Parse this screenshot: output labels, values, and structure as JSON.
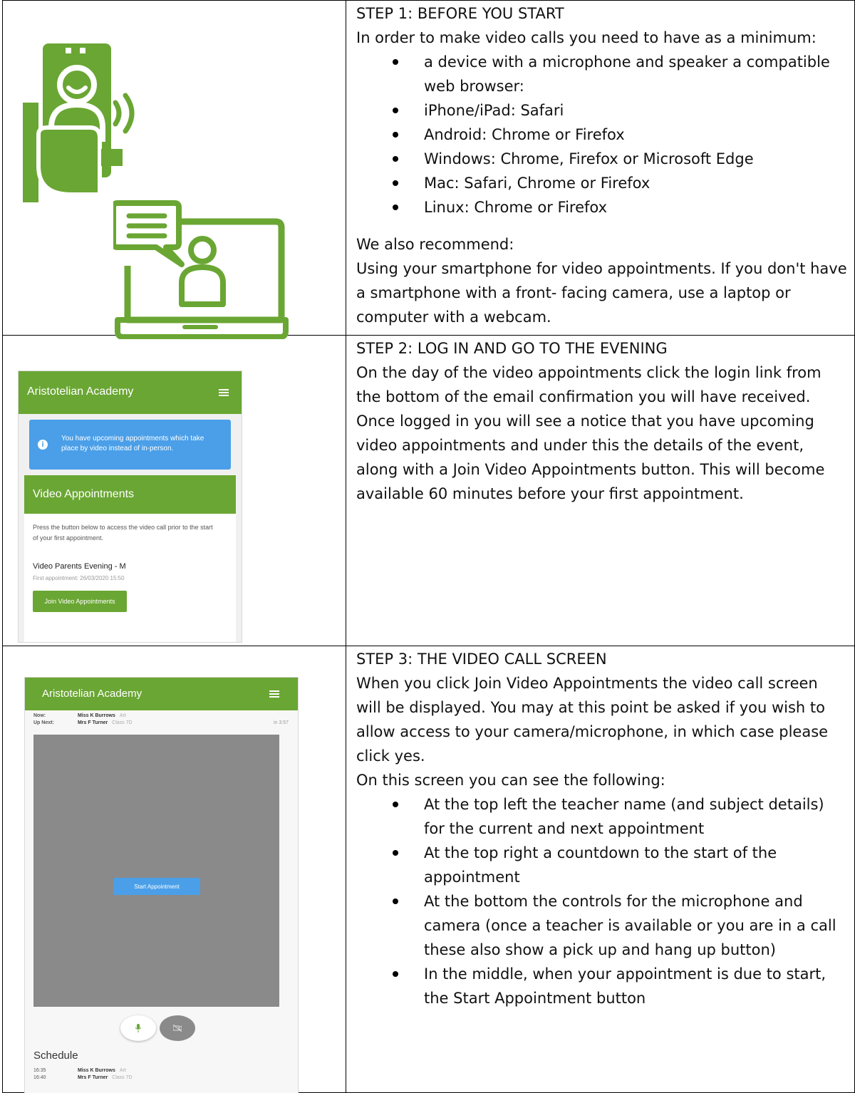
{
  "step1": {
    "title": "STEP 1: BEFORE YOU START",
    "intro": "In order to make video calls you need to have as a minimum:",
    "requirements": [
      "a device with a microphone and speaker a compatible web browser:",
      "iPhone/iPad: Safari",
      "Android: Chrome or Firefox",
      "Windows: Chrome, Firefox or Microsoft Edge",
      "Mac: Safari, Chrome or Firefox",
      "Linux: Chrome or Firefox"
    ],
    "recommend_heading": "We also recommend:",
    "recommend_text": "Using your smartphone for video appointments. If you don't have a smartphone with a front- facing camera, use a laptop or computer with a webcam."
  },
  "step2": {
    "title": "STEP 2: LOG IN AND GO TO THE EVENING",
    "text": "On the day of the video appointments click the login link from the bottom of the email confirmation you will have received. Once logged in you will see a notice that you have upcoming video appointments and under this the details of the event, along with a Join Video Appointments button. This will become available 60 minutes before your first appointment.",
    "screenshot": {
      "app_name": "Aristotelian Academy",
      "notice": "You have upcoming appointments which take place by video instead of in-person.",
      "panel_title": "Video Appointments",
      "panel_desc": "Press the button below to access the video call prior to the start of your first appointment.",
      "event_name": "Video Parents Evening - M",
      "first_appointment": "First appointment: 26/03/2020 15:50",
      "join_button": "Join Video Appointments"
    }
  },
  "step3": {
    "title": "STEP 3: THE VIDEO CALL SCREEN",
    "intro": "When you click Join Video Appointments the video call screen will be displayed. You may at this point be asked if you wish to allow access to your camera/microphone, in which case please click yes.",
    "list_intro": "On this screen you can see the following:",
    "points": [
      "At the top left the teacher name (and subject details) for the current and next appointment",
      "At the top right a countdown to the start of the appointment",
      "At the bottom the controls for the microphone and camera (once a teacher is available or you are in a call these also show a pick up and hang up button)",
      "In the middle, when your appointment is due to start, the Start Appointment button"
    ],
    "screenshot": {
      "app_name": "Aristotelian Academy",
      "now_label": "Now:",
      "now_teacher": "Miss K Burrows",
      "now_subject": "Art",
      "next_label": "Up Next:",
      "next_teacher": "Mrs F Turner",
      "next_subject": "Class 7D",
      "countdown": "in 3:57",
      "start_button": "Start Appointment",
      "schedule_title": "Schedule",
      "schedule": [
        {
          "time": "16:35",
          "teacher": "Miss K Burrows",
          "subject": "Art"
        },
        {
          "time": "16:40",
          "teacher": "Mrs F Turner",
          "subject": "Class 7D"
        }
      ]
    }
  },
  "colors": {
    "brand_green": "#6aa633",
    "notice_blue": "#4a9fe8",
    "video_gray": "#8a8a8a"
  }
}
